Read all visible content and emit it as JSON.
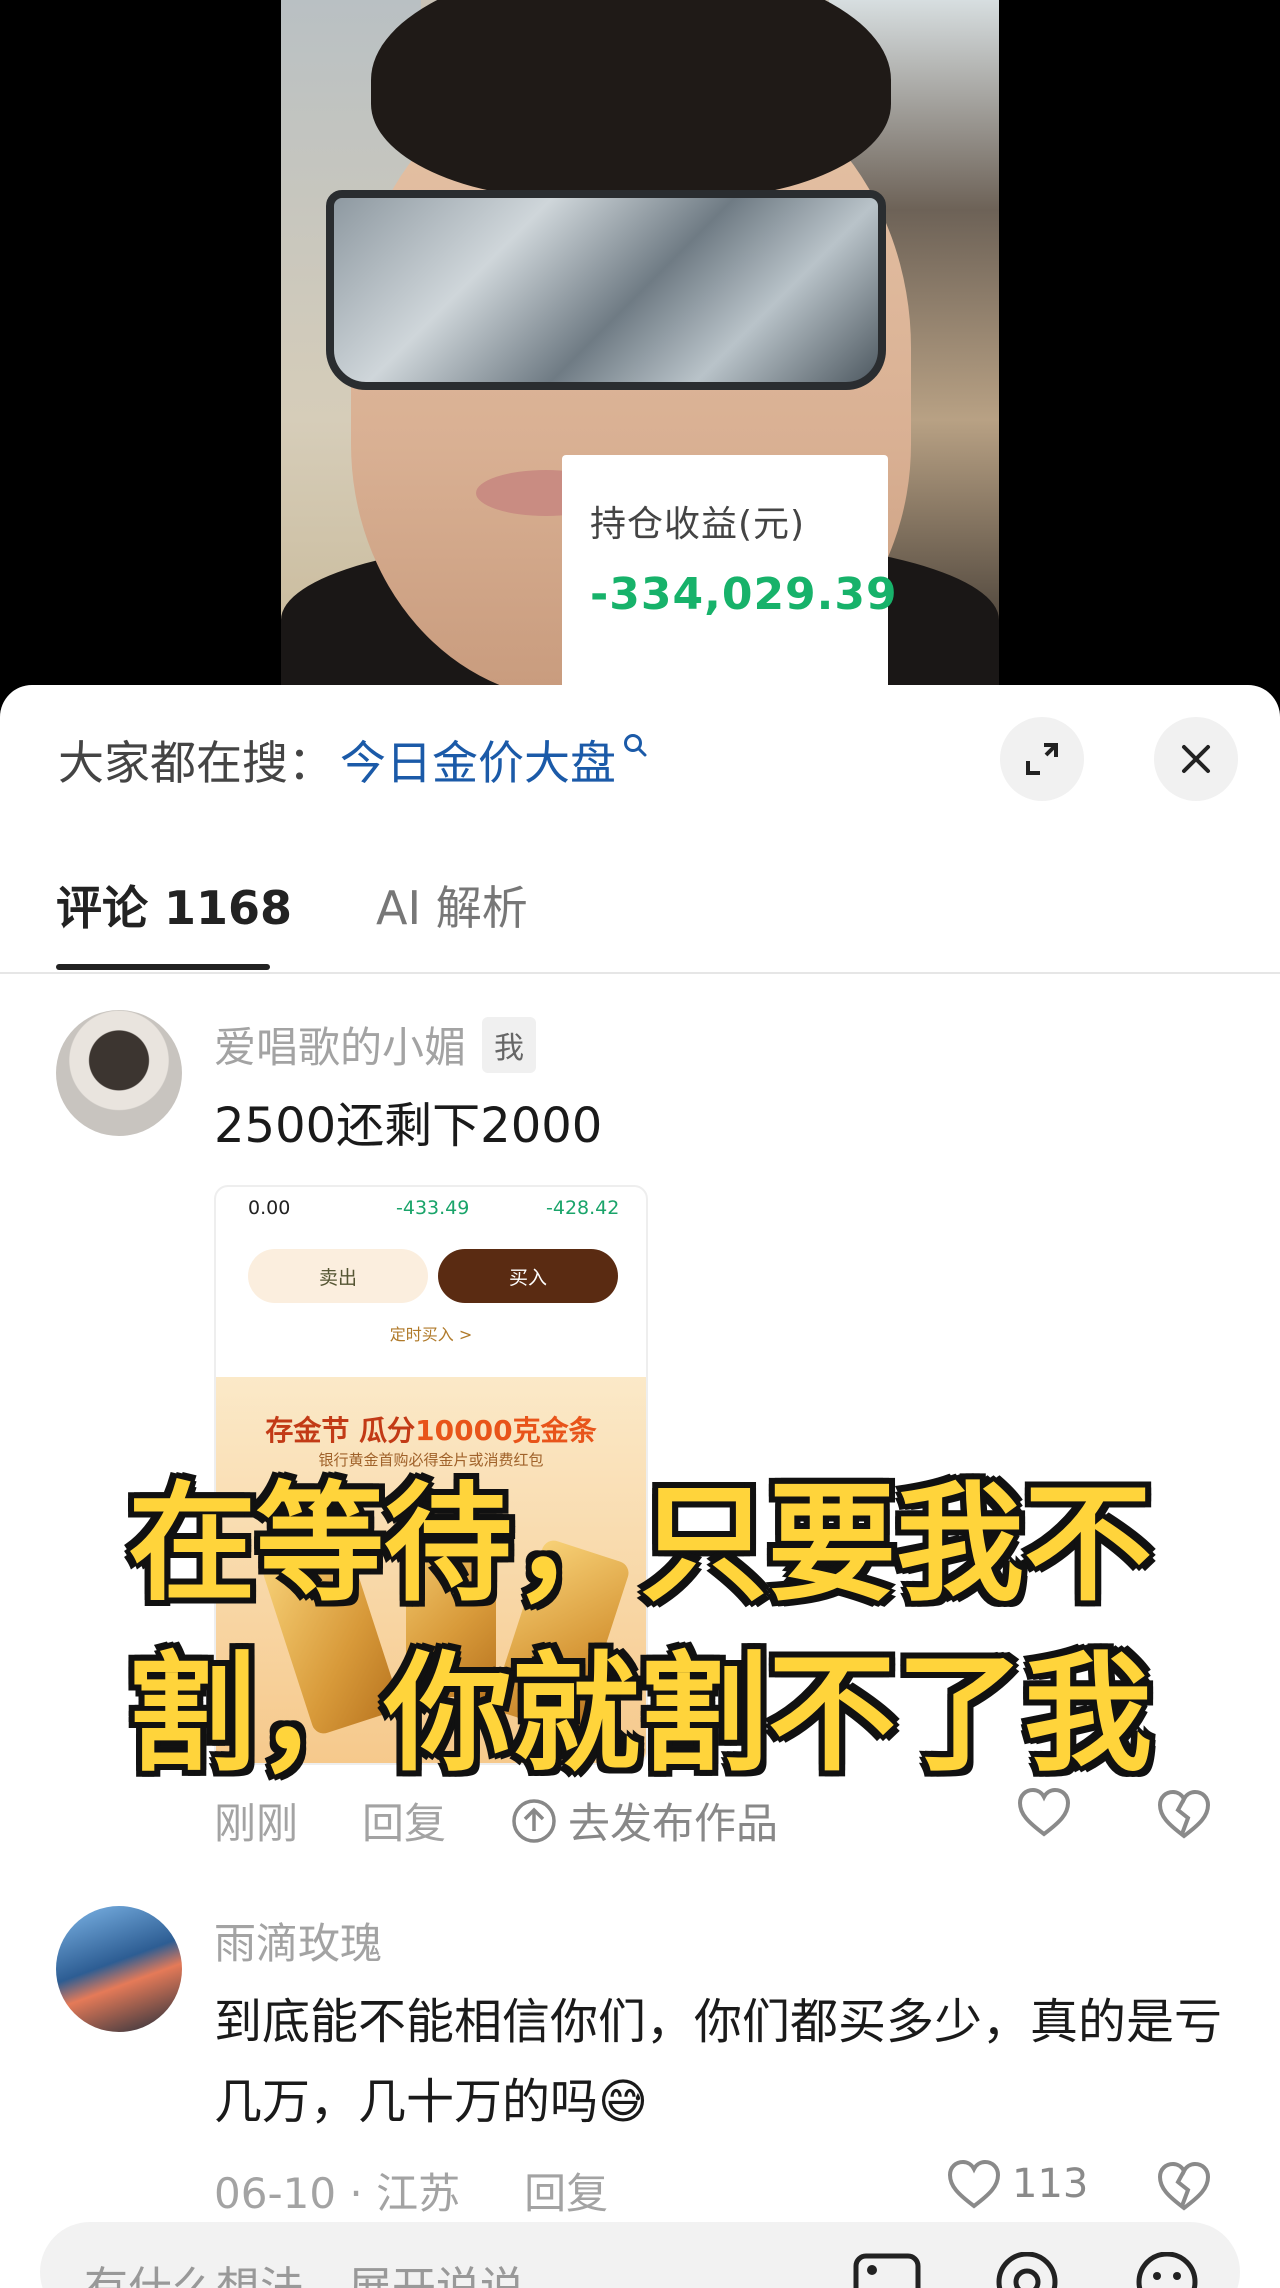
{
  "video": {
    "profit_card": {
      "label": "持仓收益(元)",
      "value": "-334,029.39"
    }
  },
  "sheet": {
    "search": {
      "prefix": "大家都在搜：",
      "query": "今日金价大盘"
    },
    "tabs": [
      {
        "label": "评论 1168",
        "active": true
      },
      {
        "label": "AI 解析",
        "active": false
      }
    ]
  },
  "comments": [
    {
      "author": "爱唱歌的小媚",
      "badge": "我",
      "text": "2500还剩下2000",
      "meta": {
        "time": "刚刚",
        "reply": "回复",
        "publish": "去发布作品"
      },
      "attachment": {
        "values": [
          "0.00",
          "-433.49",
          "-428.42"
        ],
        "sell": "卖出",
        "buy": "买入",
        "timed_buy": "定时买入 >",
        "banner_prefix": "存金节 瓜分",
        "banner_highlight": "10000克金条",
        "banner_sub": "银行黄金首购必得金片或消费红包"
      }
    },
    {
      "author": "雨滴玫瑰",
      "text": "到底能不能相信你们，你们都买多少，真的是亏几万，几十万的吗😅",
      "meta": {
        "time": "06-10 · 江苏",
        "reply": "回复",
        "likes": "113"
      }
    }
  ],
  "subtitle": {
    "line1": "在等待，只要我不",
    "line2": "割，你就割不了我"
  },
  "input": {
    "placeholder": "有什么想法，展开说说"
  },
  "colors": {
    "link": "#1b5aa8",
    "profit_negative": "#17b26a",
    "subtitle": "#ffd43b"
  }
}
